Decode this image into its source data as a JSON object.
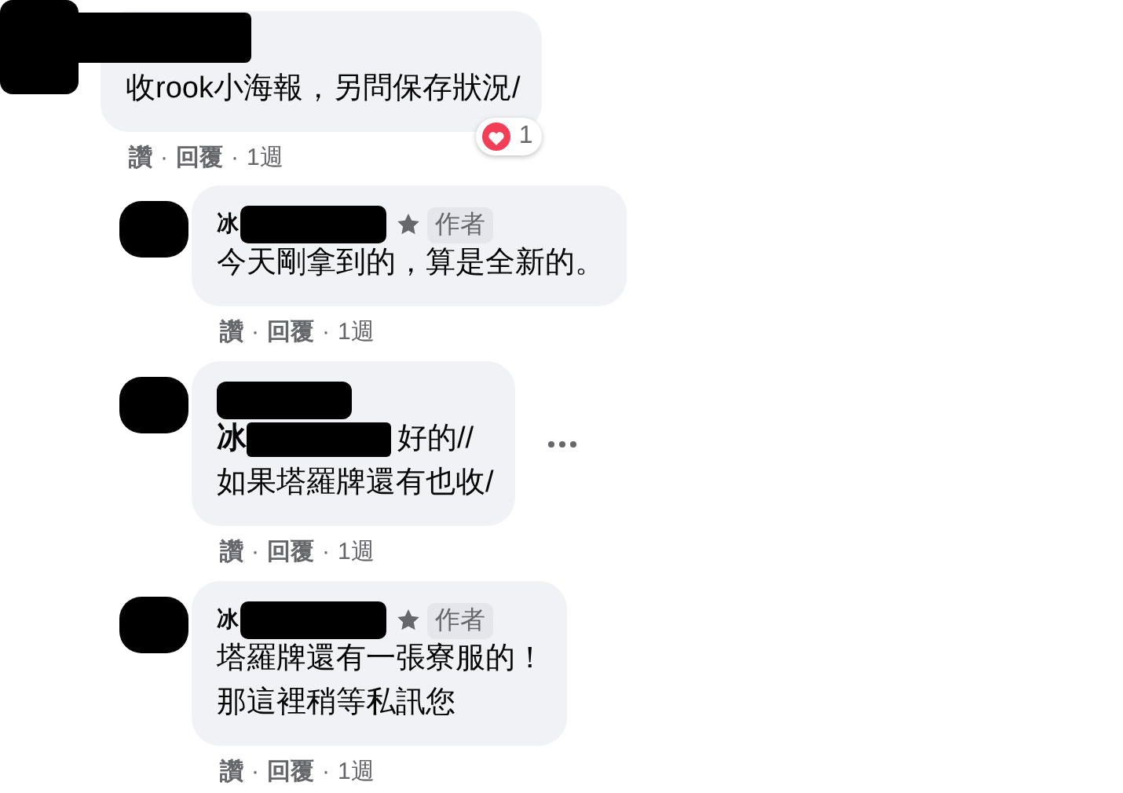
{
  "comments": [
    {
      "kind": "comment",
      "lines": [
        "收rook小海報，另問保存狀況/"
      ],
      "reactions": {
        "count": "1"
      },
      "separator": "·",
      "actions": [
        "讚",
        "回覆",
        "1週"
      ]
    },
    {
      "kind": "reply",
      "author": "冰",
      "author_badge": "作者",
      "lines": [
        "今天剛拿到的，算是全新的。"
      ],
      "separator": "·",
      "actions": [
        "讚",
        "回覆",
        "1週"
      ]
    },
    {
      "kind": "reply",
      "mention": "冰",
      "lines": [
        "好的//",
        "如果塔羅牌還有也收/"
      ],
      "more_menu": true,
      "separator": "·",
      "actions": [
        "讚",
        "回覆",
        "1週"
      ]
    },
    {
      "kind": "reply",
      "author": "冰",
      "author_badge": "作者",
      "lines": [
        "塔羅牌還有一張寮服的！",
        "那這裡稍等私訊您"
      ],
      "separator": "·",
      "actions": [
        "讚",
        "回覆",
        "1週"
      ]
    }
  ]
}
